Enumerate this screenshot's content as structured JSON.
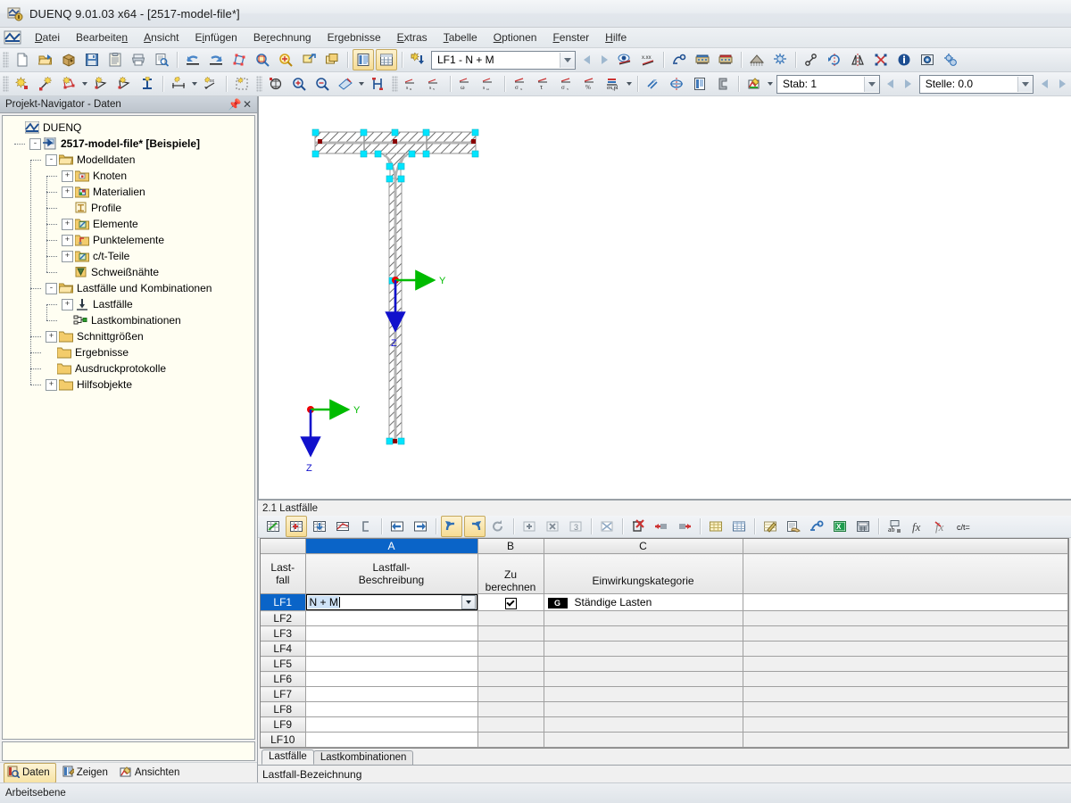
{
  "window": {
    "title": "DUENQ 9.01.03 x64 - [2517-model-file*]",
    "icon": "duenq-app-icon"
  },
  "menubar": {
    "logo": "duenq-logo-icon",
    "items": [
      {
        "label": "Datei",
        "accel": "D"
      },
      {
        "label": "Bearbeiten",
        "accel": "n"
      },
      {
        "label": "Ansicht",
        "accel": "A"
      },
      {
        "label": "Einfügen",
        "accel": "i"
      },
      {
        "label": "Berechnung",
        "accel": "r"
      },
      {
        "label": "Ergebnisse",
        "accel": "g"
      },
      {
        "label": "Extras",
        "accel": "E"
      },
      {
        "label": "Tabelle",
        "accel": "T"
      },
      {
        "label": "Optionen",
        "accel": "O"
      },
      {
        "label": "Fenster",
        "accel": "F"
      },
      {
        "label": "Hilfe",
        "accel": "H"
      }
    ]
  },
  "toolbar_main": {
    "groups": [
      [
        "new-document-icon",
        "open-folder-icon",
        "open-package-icon",
        "save-disk-icon",
        "save-all-icon",
        "print-icon",
        "print-preview-icon"
      ],
      [
        "undo-icon",
        "redo-icon",
        "edit-polygon-icon",
        "zoom-window-icon",
        "zoom-all-icon",
        "zoom-region-icon",
        "cascade-windows-icon"
      ],
      [
        "show-panel-icon",
        "show-table-icon"
      ],
      [
        "new-load-case-icon"
      ]
    ],
    "loadcase_combo": {
      "value": "LF1 - N + M",
      "name": "load-case-selector"
    },
    "after_combo": [
      "prev-loadcase-arrow",
      "next-loadcase-arrow",
      "render-view-icon",
      "numeric-values-icon",
      "measure-icon",
      "support-display-icon",
      "support-display-2-icon",
      "mesh-icon",
      "mesh-settings-icon"
    ],
    "last_group": [
      "node-snap-icon",
      "rotate-icon",
      "mirror-icon",
      "cross-section-icon",
      "info-icon",
      "photo-icon",
      "settings-gear-icon"
    ]
  },
  "toolbar_second": {
    "icons": [
      "new-node-icon",
      "new-line-icon",
      "new-polygon-icon",
      "new-element-icon",
      "new-surface-icon",
      "new-profile-icon",
      "dimension-icon",
      "dimension-xx-icon",
      "selection-frame-icon",
      "render-solid-icon",
      "zoom-in-icon",
      "zoom-out-icon",
      "pan-icon",
      "stiffener-icon"
    ],
    "stress_icons": [
      "sigma-u-icon",
      "sigma-v-icon",
      "omega-icon",
      "s-omega-icon",
      "sigma-x-icon",
      "tau-icon",
      "sigma-v2-icon",
      "percent-icon",
      "sigma-xpl-icon"
    ],
    "tail_icons": [
      "slice-icon",
      "target-icon",
      "table-view-icon",
      "c-section-icon",
      "color-palette-icon"
    ],
    "member_combo": {
      "value": "Stab: 1",
      "name": "member-selector"
    },
    "location_combo": {
      "value": "Stelle: 0.0",
      "name": "location-selector"
    }
  },
  "navigator": {
    "title": "Projekt-Navigator - Daten",
    "pin_icon": "pin-icon",
    "close_icon": "close-icon",
    "tree": [
      {
        "label": "DUENQ",
        "depth": 0,
        "icon": "duenq-root-icon",
        "expander": "",
        "bold": false
      },
      {
        "label": "2517-model-file* [Beispiele]",
        "depth": 1,
        "icon": "model-file-icon",
        "expander": "-",
        "bold": true
      },
      {
        "label": "Modelldaten",
        "depth": 2,
        "icon": "folder-open-icon",
        "expander": "-",
        "bold": false
      },
      {
        "label": "Knoten",
        "depth": 3,
        "icon": "node-folder-icon",
        "expander": "+",
        "bold": false
      },
      {
        "label": "Materialien",
        "depth": 3,
        "icon": "material-folder-icon",
        "expander": "+",
        "bold": false
      },
      {
        "label": "Profile",
        "depth": 3,
        "icon": "profile-folder-icon",
        "expander": "",
        "bold": false
      },
      {
        "label": "Elemente",
        "depth": 3,
        "icon": "element-folder-icon",
        "expander": "+",
        "bold": false
      },
      {
        "label": "Punktelemente",
        "depth": 3,
        "icon": "point-element-folder-icon",
        "expander": "+",
        "bold": false
      },
      {
        "label": "c/t-Teile",
        "depth": 3,
        "icon": "ct-parts-folder-icon",
        "expander": "+",
        "bold": false
      },
      {
        "label": "Schweißnähte",
        "depth": 3,
        "icon": "weld-folder-icon",
        "expander": "",
        "bold": false
      },
      {
        "label": "Lastfälle und Kombinationen",
        "depth": 2,
        "icon": "folder-open-icon",
        "expander": "-",
        "bold": false
      },
      {
        "label": "Lastfälle",
        "depth": 3,
        "icon": "load-case-icon",
        "expander": "+",
        "bold": false
      },
      {
        "label": "Lastkombinationen",
        "depth": 3,
        "icon": "load-combination-icon",
        "expander": "",
        "bold": false
      },
      {
        "label": "Schnittgrößen",
        "depth": 2,
        "icon": "folder-icon",
        "expander": "+",
        "bold": false
      },
      {
        "label": "Ergebnisse",
        "depth": 2,
        "icon": "folder-icon",
        "expander": "",
        "bold": false
      },
      {
        "label": "Ausdruckprotokolle",
        "depth": 2,
        "icon": "folder-icon",
        "expander": "",
        "bold": false
      },
      {
        "label": "Hilfsobjekte",
        "depth": 2,
        "icon": "folder-icon",
        "expander": "+",
        "bold": false
      }
    ],
    "tabs": [
      {
        "label": "Daten",
        "icon": "data-tab-icon",
        "active": true
      },
      {
        "label": "Zeigen",
        "icon": "show-tab-icon",
        "active": false
      },
      {
        "label": "Ansichten",
        "icon": "views-tab-icon",
        "active": false
      }
    ]
  },
  "cad": {
    "axes": [
      {
        "name": "origin-axes",
        "y_label": "Y",
        "z_label": "Z"
      },
      {
        "name": "global-axes",
        "y_label": "Y",
        "z_label": "Z"
      }
    ],
    "colors": {
      "node": "#00e5ff",
      "origin": "#ff0000",
      "axis_y": "#00cc00",
      "axis_z": "#0000cc",
      "hatch": "#555555",
      "section_fill": "#c8c8c8",
      "support": "#8b0000"
    }
  },
  "table_panel": {
    "title": "2.1 Lastfälle",
    "toolbar_icons": [
      "new-table-icon",
      "insert-row-icon",
      "append-row-icon",
      "table-chart-icon",
      "bracket-icon",
      "move-left-icon",
      "move-right-icon",
      "undo-table-icon",
      "redo-table-icon",
      "refresh-icon",
      "add-icon",
      "delete-row-icon",
      "info-row-icon",
      "clear-table-icon",
      "delete-all-icon",
      "remove-col-icon",
      "insert-col-icon",
      "grid-yellow-icon",
      "grid-blue-icon",
      "edit-pencil-icon",
      "handshake-icon",
      "wrench-icon",
      "excel-export-icon",
      "calculator-icon",
      "rename-icon",
      "function-icon",
      "function-del-icon",
      "ct-icon"
    ],
    "columns": [
      {
        "id": "rowhdr",
        "letter": "",
        "name": "Last-\nfall",
        "selected": false
      },
      {
        "id": "A",
        "letter": "A",
        "name": "Lastfall-\nBeschreibung",
        "selected": true
      },
      {
        "id": "B",
        "letter": "B",
        "name": "Zu berechnen",
        "selected": false
      },
      {
        "id": "C",
        "letter": "C",
        "name": "Einwirkungskategorie",
        "selected": false
      },
      {
        "id": "D",
        "letter": "",
        "name": "",
        "selected": false
      }
    ],
    "column_headers": {
      "rowhdr_line1": "Last-",
      "rowhdr_line2": "fall",
      "a_line1": "Lastfall-",
      "a_line2": "Beschreibung",
      "b_label": "Zu berechnen",
      "c_label": "Einwirkungskategorie"
    },
    "rows": [
      {
        "id": "LF1",
        "selected": true,
        "editing": true,
        "description": "N + M",
        "zu_berechnen": true,
        "kategorie_badge": "G",
        "kategorie": "Ständige Lasten"
      },
      {
        "id": "LF2",
        "selected": false,
        "editing": false,
        "description": "",
        "zu_berechnen": false,
        "kategorie_badge": "",
        "kategorie": ""
      },
      {
        "id": "LF3",
        "selected": false,
        "editing": false,
        "description": "",
        "zu_berechnen": false,
        "kategorie_badge": "",
        "kategorie": ""
      },
      {
        "id": "LF4",
        "selected": false,
        "editing": false,
        "description": "",
        "zu_berechnen": false,
        "kategorie_badge": "",
        "kategorie": ""
      },
      {
        "id": "LF5",
        "selected": false,
        "editing": false,
        "description": "",
        "zu_berechnen": false,
        "kategorie_badge": "",
        "kategorie": ""
      },
      {
        "id": "LF6",
        "selected": false,
        "editing": false,
        "description": "",
        "zu_berechnen": false,
        "kategorie_badge": "",
        "kategorie": ""
      },
      {
        "id": "LF7",
        "selected": false,
        "editing": false,
        "description": "",
        "zu_berechnen": false,
        "kategorie_badge": "",
        "kategorie": ""
      },
      {
        "id": "LF8",
        "selected": false,
        "editing": false,
        "description": "",
        "zu_berechnen": false,
        "kategorie_badge": "",
        "kategorie": ""
      },
      {
        "id": "LF9",
        "selected": false,
        "editing": false,
        "description": "",
        "zu_berechnen": false,
        "kategorie_badge": "",
        "kategorie": ""
      },
      {
        "id": "LF10",
        "selected": false,
        "editing": false,
        "description": "",
        "zu_berechnen": false,
        "kategorie_badge": "",
        "kategorie": ""
      }
    ],
    "tabs": [
      {
        "label": "Lastfälle",
        "active": true
      },
      {
        "label": "Lastkombinationen",
        "active": false
      }
    ],
    "status": "Lastfall-Bezeichnung"
  },
  "statusbar": {
    "text": "Arbeitsebene"
  }
}
